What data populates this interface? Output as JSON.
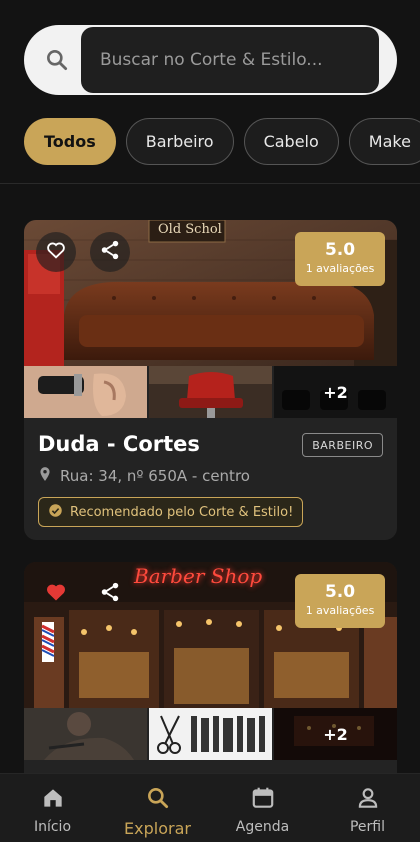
{
  "search": {
    "placeholder": "Buscar no Corte & Estilo..."
  },
  "filters": [
    {
      "label": "Todos",
      "active": true
    },
    {
      "label": "Barbeiro",
      "active": false
    },
    {
      "label": "Cabelo",
      "active": false
    },
    {
      "label": "Make",
      "active": false
    }
  ],
  "cards": [
    {
      "name": "Duda - Cortes",
      "type": "BARBEIRO",
      "address": "Rua: 34, nº 650A - centro",
      "rating": "5.0",
      "reviews": "1 avaliações",
      "recommended": "Recomendado pelo Corte & Estilo!",
      "favorited": false,
      "hero_sign": "Old Schol",
      "more_photos": "+2"
    },
    {
      "rating": "5.0",
      "reviews": "1 avaliações",
      "favorited": true,
      "hero_sign": "Barber Shop",
      "more_photos": "+2"
    }
  ],
  "nav": [
    {
      "label": "Início",
      "icon": "home-icon",
      "active": false
    },
    {
      "label": "Explorar",
      "icon": "search-icon",
      "active": true
    },
    {
      "label": "Agenda",
      "icon": "calendar-icon",
      "active": false
    },
    {
      "label": "Perfil",
      "icon": "person-icon",
      "active": false
    }
  ],
  "colors": {
    "accent": "#c9a558",
    "background": "#131313",
    "card": "#232323",
    "favorite": "#e53935"
  }
}
